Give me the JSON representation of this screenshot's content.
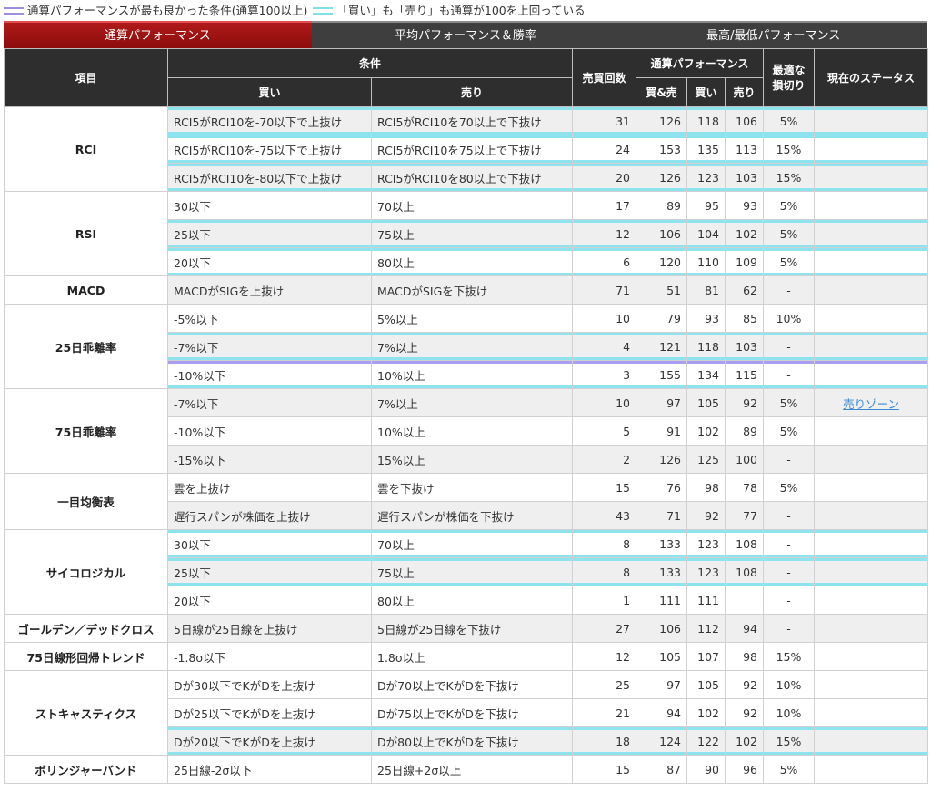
{
  "legend": {
    "purple_text": "通算パフォーマンスが最も良かった条件(通算100以上)",
    "cyan_text": "「買い」も「売り」も通算が100を上回っている"
  },
  "tabs": [
    "通算パフォーマンス",
    "平均パフォーマンス＆勝率",
    "最高/最低パフォーマンス"
  ],
  "headers": {
    "item": "項目",
    "condition": "条件",
    "buy": "買い",
    "sell": "売り",
    "trades": "売買回数",
    "perf": "通算パフォーマンス",
    "both": "買&売",
    "perf_buy": "買い",
    "perf_sell": "売り",
    "stoploss": "最適な\n損切り",
    "status": "現在のステータス"
  },
  "groups": [
    {
      "name": "RCI",
      "rows": [
        {
          "buy": "RCI5がRCI10を-70以下で上抜け",
          "sell": "RCI5がRCI10を70以上で下抜け",
          "n": "31",
          "both": "126",
          "b": "118",
          "s": "106",
          "sl": "5%",
          "st": "",
          "g": true,
          "hl": "cyan"
        },
        {
          "buy": "RCI5がRCI10を-75以下で上抜け",
          "sell": "RCI5がRCI10を75以上で下抜け",
          "n": "24",
          "both": "153",
          "b": "135",
          "s": "113",
          "sl": "15%",
          "st": "",
          "g": false,
          "hl": "cyan"
        },
        {
          "buy": "RCI5がRCI10を-80以下で上抜け",
          "sell": "RCI5がRCI10を80以上で下抜け",
          "n": "20",
          "both": "126",
          "b": "123",
          "s": "103",
          "sl": "15%",
          "st": "",
          "g": true,
          "hl": "cyan"
        }
      ]
    },
    {
      "name": "RSI",
      "rows": [
        {
          "buy": "30以下",
          "sell": "70以上",
          "n": "17",
          "both": "89",
          "b": "95",
          "s": "93",
          "sl": "5%",
          "st": "",
          "g": false,
          "hl": ""
        },
        {
          "buy": "25以下",
          "sell": "75以上",
          "n": "12",
          "both": "106",
          "b": "104",
          "s": "102",
          "sl": "5%",
          "st": "",
          "g": true,
          "hl": "cyan"
        },
        {
          "buy": "20以下",
          "sell": "80以上",
          "n": "6",
          "both": "120",
          "b": "110",
          "s": "109",
          "sl": "5%",
          "st": "",
          "g": false,
          "hl": "cyan"
        }
      ]
    },
    {
      "name": "MACD",
      "rows": [
        {
          "buy": "MACDがSIGを上抜け",
          "sell": "MACDがSIGを下抜け",
          "n": "71",
          "both": "51",
          "b": "81",
          "s": "62",
          "sl": "-",
          "st": "",
          "g": true,
          "hl": ""
        }
      ]
    },
    {
      "name": "25日乖離率",
      "rows": [
        {
          "buy": "-5%以下",
          "sell": "5%以上",
          "n": "10",
          "both": "79",
          "b": "93",
          "s": "85",
          "sl": "10%",
          "st": "",
          "g": false,
          "hl": ""
        },
        {
          "buy": "-7%以下",
          "sell": "7%以上",
          "n": "4",
          "both": "121",
          "b": "118",
          "s": "103",
          "sl": "-",
          "st": "",
          "g": true,
          "hl": "cyan"
        },
        {
          "buy": "-10%以下",
          "sell": "10%以上",
          "n": "3",
          "both": "155",
          "b": "134",
          "s": "115",
          "sl": "-",
          "st": "",
          "g": false,
          "hl": "purple"
        }
      ]
    },
    {
      "name": "75日乖離率",
      "rows": [
        {
          "buy": "-7%以下",
          "sell": "7%以上",
          "n": "10",
          "both": "97",
          "b": "105",
          "s": "92",
          "sl": "5%",
          "st": "売りゾーン",
          "g": true,
          "hl": ""
        },
        {
          "buy": "-10%以下",
          "sell": "10%以上",
          "n": "5",
          "both": "91",
          "b": "102",
          "s": "89",
          "sl": "5%",
          "st": "",
          "g": false,
          "hl": ""
        },
        {
          "buy": "-15%以下",
          "sell": "15%以上",
          "n": "2",
          "both": "126",
          "b": "125",
          "s": "100",
          "sl": "-",
          "st": "",
          "g": true,
          "hl": ""
        }
      ]
    },
    {
      "name": "一目均衡表",
      "rows": [
        {
          "buy": "雲を上抜け",
          "sell": "雲を下抜け",
          "n": "15",
          "both": "76",
          "b": "98",
          "s": "78",
          "sl": "5%",
          "st": "",
          "g": false,
          "hl": ""
        },
        {
          "buy": "遅行スパンが株価を上抜け",
          "sell": "遅行スパンが株価を下抜け",
          "n": "43",
          "both": "71",
          "b": "92",
          "s": "77",
          "sl": "-",
          "st": "",
          "g": true,
          "hl": ""
        }
      ]
    },
    {
      "name": "サイコロジカル",
      "rows": [
        {
          "buy": "30以下",
          "sell": "70以上",
          "n": "8",
          "both": "133",
          "b": "123",
          "s": "108",
          "sl": "-",
          "st": "",
          "g": false,
          "hl": "cyan"
        },
        {
          "buy": "25以下",
          "sell": "75以上",
          "n": "8",
          "both": "133",
          "b": "123",
          "s": "108",
          "sl": "-",
          "st": "",
          "g": true,
          "hl": "cyan"
        },
        {
          "buy": "20以下",
          "sell": "80以上",
          "n": "1",
          "both": "111",
          "b": "111",
          "s": "",
          "sl": "-",
          "st": "",
          "g": false,
          "hl": ""
        }
      ]
    },
    {
      "name": "ゴールデン／デッドクロス",
      "rows": [
        {
          "buy": "5日線が25日線を上抜け",
          "sell": "5日線が25日線を下抜け",
          "n": "27",
          "both": "106",
          "b": "112",
          "s": "94",
          "sl": "-",
          "st": "",
          "g": true,
          "hl": ""
        }
      ]
    },
    {
      "name": "75日線形回帰トレンド",
      "rows": [
        {
          "buy": "-1.8σ以下",
          "sell": "1.8σ以上",
          "n": "12",
          "both": "105",
          "b": "107",
          "s": "98",
          "sl": "15%",
          "st": "",
          "g": false,
          "hl": ""
        }
      ]
    },
    {
      "name": "ストキャスティクス",
      "rows": [
        {
          "buy": "Dが30以下でKがDを上抜け",
          "sell": "Dが70以上でKがDを下抜け",
          "n": "25",
          "both": "97",
          "b": "105",
          "s": "92",
          "sl": "10%",
          "st": "",
          "g": false,
          "hl": ""
        },
        {
          "buy": "Dが25以下でKがDを上抜け",
          "sell": "Dが75以上でKがDを下抜け",
          "n": "21",
          "both": "94",
          "b": "102",
          "s": "92",
          "sl": "10%",
          "st": "",
          "g": false,
          "hl": ""
        },
        {
          "buy": "Dが20以下でKがDを上抜け",
          "sell": "Dが80以上でKがDを下抜け",
          "n": "18",
          "both": "124",
          "b": "122",
          "s": "102",
          "sl": "15%",
          "st": "",
          "g": true,
          "hl": "cyan"
        }
      ]
    },
    {
      "name": "ボリンジャーバンド",
      "rows": [
        {
          "buy": "25日線-2σ以下",
          "sell": "25日線+2σ以上",
          "n": "15",
          "both": "87",
          "b": "90",
          "s": "96",
          "sl": "5%",
          "st": "",
          "g": false,
          "hl": ""
        }
      ]
    }
  ]
}
